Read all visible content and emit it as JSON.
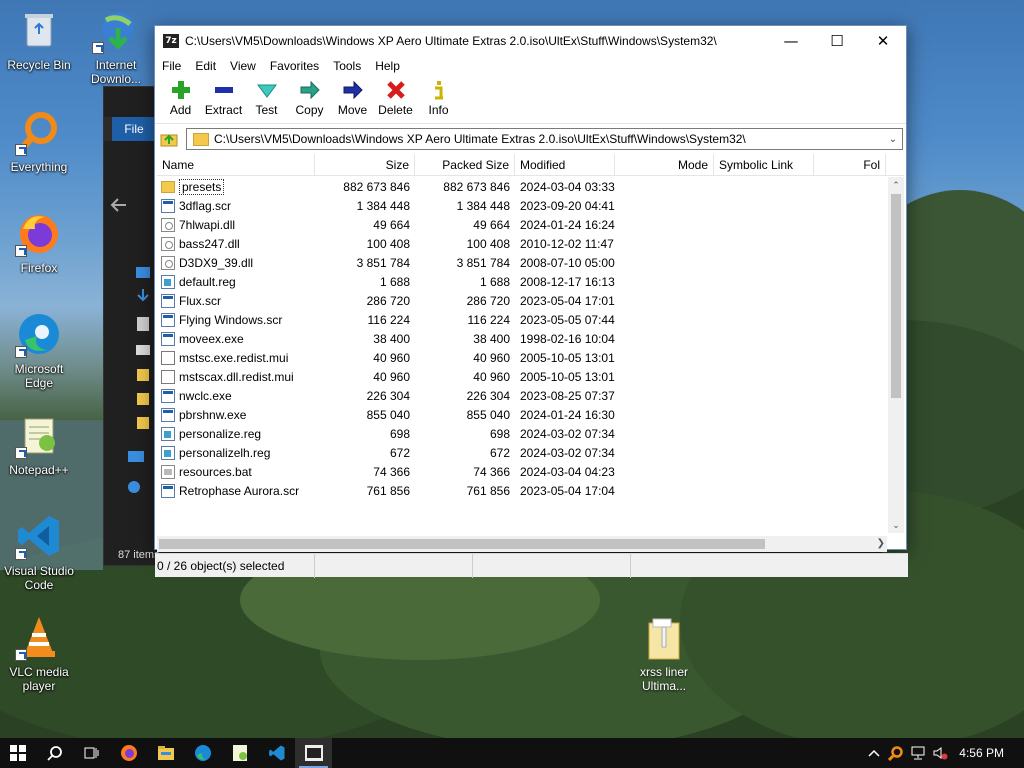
{
  "desktop": {
    "icons": [
      {
        "label": "Recycle Bin",
        "icon": "recycle-bin-icon"
      },
      {
        "label": "Internet Downlo...",
        "icon": "internet-download-manager-icon"
      },
      {
        "label": "Everything",
        "icon": "everything-search-icon"
      },
      {
        "label": "Firefox",
        "icon": "firefox-icon"
      },
      {
        "label": "Microsoft Edge",
        "icon": "edge-icon"
      },
      {
        "label": "Notepad++",
        "icon": "notepadpp-icon"
      },
      {
        "label": "Visual Studio Code",
        "icon": "vscode-icon"
      },
      {
        "label": "VLC media player",
        "icon": "vlc-icon"
      }
    ],
    "file": {
      "label": "xrss liner Ultima...",
      "icon": "folder-zip-icon"
    }
  },
  "explorer": {
    "file_tab": "File",
    "status": "87 items"
  },
  "sevenzip": {
    "title": "C:\\Users\\VM5\\Downloads\\Windows XP Aero Ultimate Extras 2.0.iso\\UltEx\\Stuff\\Windows\\System32\\",
    "app_icon_text": "7z",
    "menu": [
      "File",
      "Edit",
      "View",
      "Favorites",
      "Tools",
      "Help"
    ],
    "toolbar": [
      {
        "label": "Add",
        "icon": "add-plus-icon"
      },
      {
        "label": "Extract",
        "icon": "extract-minus-icon"
      },
      {
        "label": "Test",
        "icon": "test-check-icon"
      },
      {
        "label": "Copy",
        "icon": "copy-arrow-icon"
      },
      {
        "label": "Move",
        "icon": "move-arrow-icon"
      },
      {
        "label": "Delete",
        "icon": "delete-x-icon"
      },
      {
        "label": "Info",
        "icon": "info-icon"
      }
    ],
    "address": "C:\\Users\\VM5\\Downloads\\Windows XP Aero Ultimate Extras 2.0.iso\\UltEx\\Stuff\\Windows\\System32\\",
    "columns": {
      "name": "Name",
      "size": "Size",
      "packed": "Packed Size",
      "modified": "Modified",
      "mode": "Mode",
      "symlink": "Symbolic Link",
      "folders": "Fol"
    },
    "files": [
      {
        "name": "presets",
        "size": "882 673 846",
        "packed": "882 673 846",
        "modified": "2024-03-04 03:33",
        "type": "folder"
      },
      {
        "name": "3dflag.scr",
        "size": "1 384 448",
        "packed": "1 384 448",
        "modified": "2023-09-20 04:41",
        "type": "exe"
      },
      {
        "name": "7hlwapi.dll",
        "size": "49 664",
        "packed": "49 664",
        "modified": "2024-01-24 16:24",
        "type": "dll"
      },
      {
        "name": "bass247.dll",
        "size": "100 408",
        "packed": "100 408",
        "modified": "2010-12-02 11:47",
        "type": "dll"
      },
      {
        "name": "D3DX9_39.dll",
        "size": "3 851 784",
        "packed": "3 851 784",
        "modified": "2008-07-10 05:00",
        "type": "dll"
      },
      {
        "name": "default.reg",
        "size": "1 688",
        "packed": "1 688",
        "modified": "2008-12-17 16:13",
        "type": "reg"
      },
      {
        "name": "Flux.scr",
        "size": "286 720",
        "packed": "286 720",
        "modified": "2023-05-04 17:01",
        "type": "exe"
      },
      {
        "name": "Flying Windows.scr",
        "size": "116 224",
        "packed": "116 224",
        "modified": "2023-05-05 07:44",
        "type": "exe"
      },
      {
        "name": "moveex.exe",
        "size": "38 400",
        "packed": "38 400",
        "modified": "1998-02-16 10:04",
        "type": "exe"
      },
      {
        "name": "mstsc.exe.redist.mui",
        "size": "40 960",
        "packed": "40 960",
        "modified": "2005-10-05 13:01",
        "type": "file"
      },
      {
        "name": "mstscax.dll.redist.mui",
        "size": "40 960",
        "packed": "40 960",
        "modified": "2005-10-05 13:01",
        "type": "file"
      },
      {
        "name": "nwclc.exe",
        "size": "226 304",
        "packed": "226 304",
        "modified": "2023-08-25 07:37",
        "type": "exe"
      },
      {
        "name": "pbrshnw.exe",
        "size": "855 040",
        "packed": "855 040",
        "modified": "2024-01-24 16:30",
        "type": "exe"
      },
      {
        "name": "personalize.reg",
        "size": "698",
        "packed": "698",
        "modified": "2024-03-02 07:34",
        "type": "reg"
      },
      {
        "name": "personalizelh.reg",
        "size": "672",
        "packed": "672",
        "modified": "2024-03-02 07:34",
        "type": "reg"
      },
      {
        "name": "resources.bat",
        "size": "74 366",
        "packed": "74 366",
        "modified": "2024-03-04 04:23",
        "type": "bat"
      },
      {
        "name": "Retrophase Aurora.scr",
        "size": "761 856",
        "packed": "761 856",
        "modified": "2023-05-04 17:04",
        "type": "exe"
      }
    ],
    "status": "0 / 26 object(s) selected"
  },
  "taskbar": {
    "items": [
      "start-windows-icon",
      "search-icon",
      "task-view-icon",
      "firefox-icon",
      "file-explorer-icon",
      "edge-icon",
      "notepadpp-icon",
      "vscode-icon",
      "sevenzip-icon"
    ],
    "clock": "4:56 PM"
  }
}
